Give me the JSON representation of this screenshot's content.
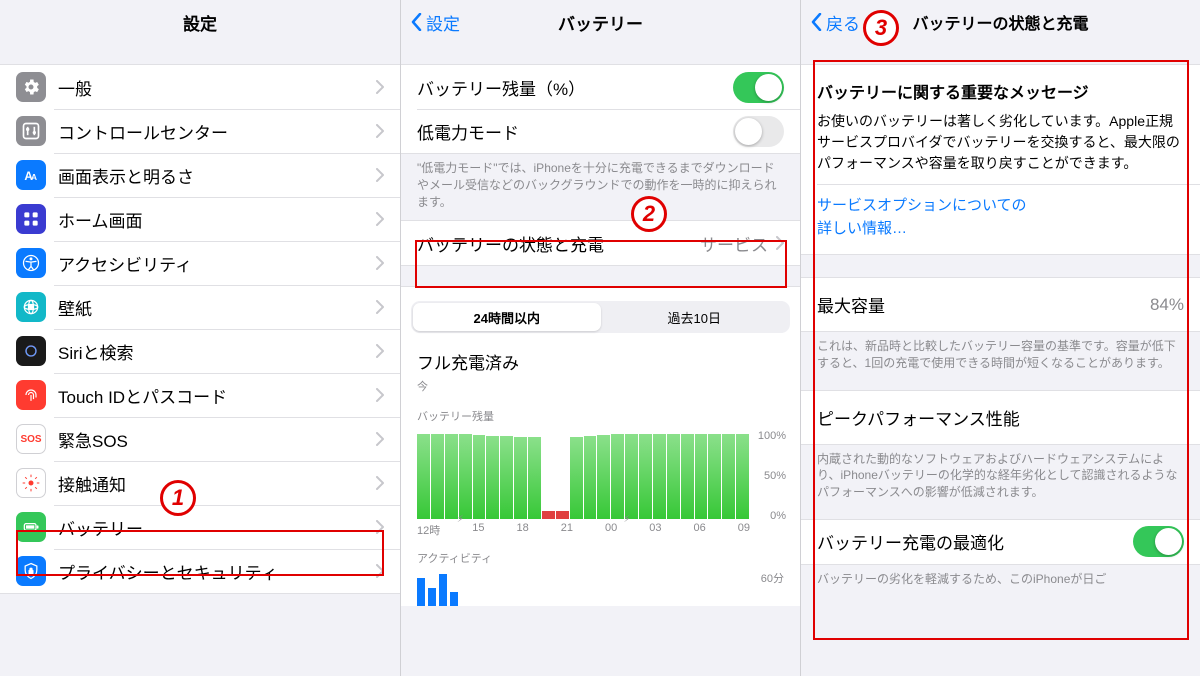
{
  "col1": {
    "title": "設定",
    "items": [
      {
        "name": "general",
        "label": "一般",
        "bg": "#8e8e93"
      },
      {
        "name": "control-center",
        "label": "コントロールセンター",
        "bg": "#8e8e93"
      },
      {
        "name": "display",
        "label": "画面表示と明るさ",
        "bg": "#0a7aff"
      },
      {
        "name": "home-screen",
        "label": "ホーム画面",
        "bg": "#3a3bd1"
      },
      {
        "name": "accessibility",
        "label": "アクセシビリティ",
        "bg": "#0a7aff"
      },
      {
        "name": "wallpaper",
        "label": "壁紙",
        "bg": "#12b8c8"
      },
      {
        "name": "siri",
        "label": "Siriと検索",
        "bg": "#1a1a1a"
      },
      {
        "name": "touchid",
        "label": "Touch IDとパスコード",
        "bg": "#ff3b30"
      },
      {
        "name": "sos",
        "label": "緊急SOS",
        "bg": "#ffffff",
        "fg": "#ff3b30",
        "text": "SOS",
        "border": true
      },
      {
        "name": "exposure",
        "label": "接触通知",
        "bg": "#ffffff",
        "fg": "#ff3b30",
        "border": true
      },
      {
        "name": "battery",
        "label": "バッテリー",
        "bg": "#34c759"
      },
      {
        "name": "privacy",
        "label": "プライバシーとセキュリティ",
        "bg": "#0a7aff"
      }
    ]
  },
  "col2": {
    "back": "設定",
    "title": "バッテリー",
    "percent_label": "バッテリー残量（%）",
    "lowpower_label": "低電力モード",
    "lowpower_note": "\"低電力モード\"では、iPhoneを十分に充電できるまでダウンロードやメール受信などのバックグラウンドでの動作を一時的に抑えられます。",
    "health_label": "バッテリーの状態と充電",
    "health_detail": "サービス",
    "seg_24h": "24時間以内",
    "seg_10d": "過去10日",
    "fullcharge": "フル充電済み",
    "fullcharge_sub": "今",
    "chart_section": "バッテリー残量",
    "activity": "アクティビティ"
  },
  "col3": {
    "back": "戻る",
    "title": "バッテリーの状態と充電",
    "msg_title": "バッテリーに関する重要なメッセージ",
    "msg_body": "お使いのバッテリーは著しく劣化しています。Apple正規サービスプロバイダでバッテリーを交換すると、最大限のパフォーマンスや容量を取り戻すことができます。",
    "link": "サービスオプションについての\n詳しい情報…",
    "max_cap_label": "最大容量",
    "max_cap_value": "84%",
    "max_cap_note": "これは、新品時と比較したバッテリー容量の基準です。容量が低下すると、1回の充電で使用できる時間が短くなることがあります。",
    "peak_label": "ピークパフォーマンス性能",
    "peak_note": "内蔵された動的なソフトウェアおよびハードウェアシステムにより、iPhoneバッテリーの化学的な経年劣化として認識されるようなパフォーマンスへの影響が低減されます。",
    "opt_label": "バッテリー充電の最適化",
    "opt_note": "バッテリーの劣化を軽減するため、このiPhoneが日ご"
  },
  "chart_data": {
    "type": "bar",
    "title": "バッテリー残量",
    "x_ticks": [
      "12時",
      "15",
      "18",
      "21",
      "00",
      "03",
      "06",
      "09"
    ],
    "y_ticks": [
      0,
      50,
      100
    ],
    "values": [
      100,
      100,
      100,
      100,
      99,
      98,
      98,
      97,
      97,
      10,
      10,
      97,
      98,
      99,
      100,
      100,
      100,
      100,
      100,
      100,
      100,
      100,
      100,
      100
    ],
    "ylim": [
      0,
      100
    ],
    "activity_label": "アクティビティ",
    "activity_y_tick": "60分"
  }
}
